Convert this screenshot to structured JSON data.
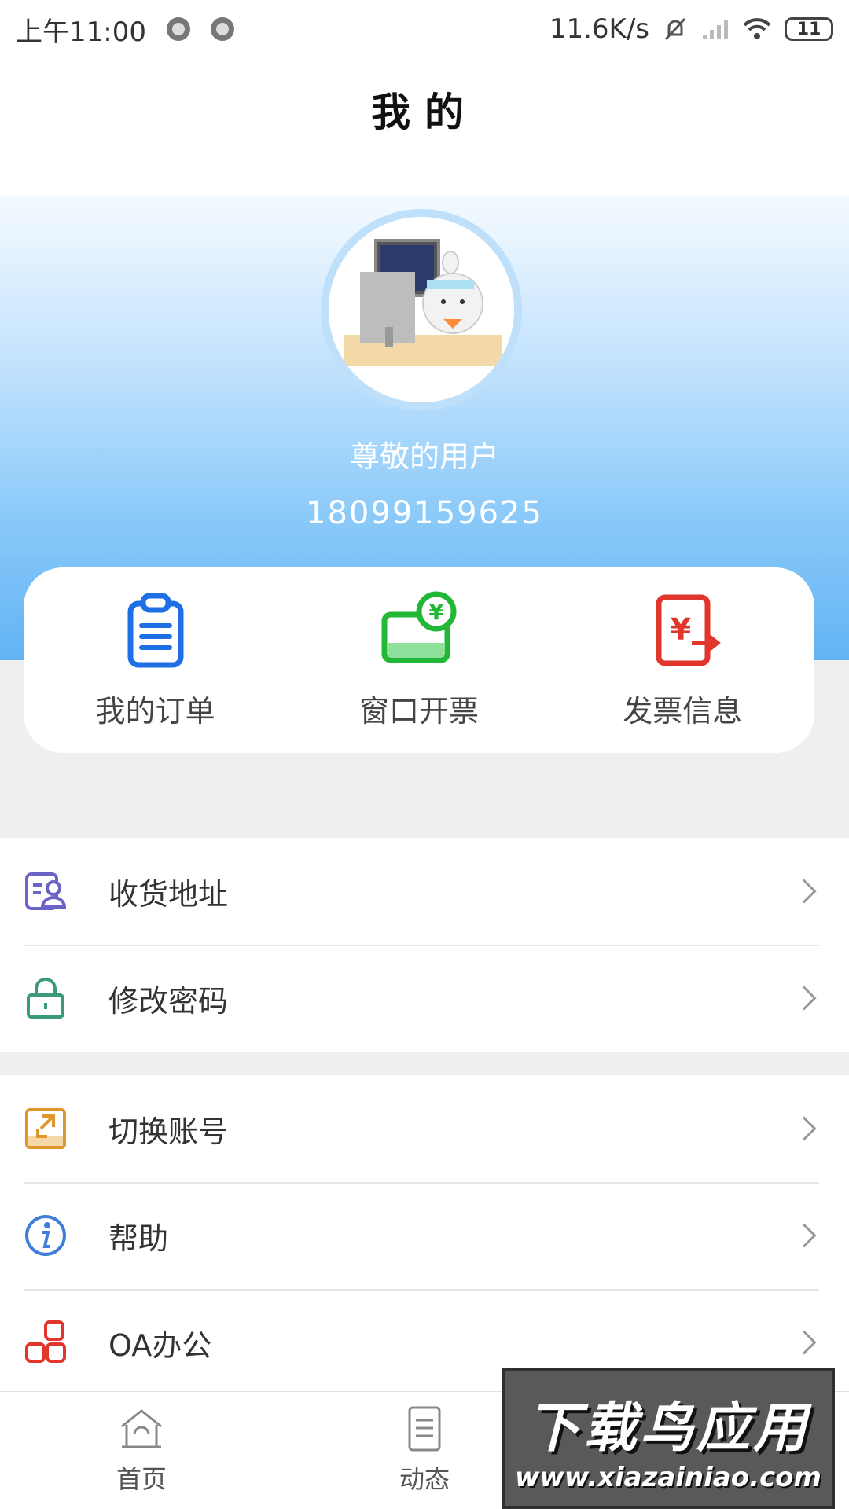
{
  "status_bar": {
    "time": "上午11:00",
    "speed": "11.6K/s",
    "battery": "11"
  },
  "header": {
    "title": "我的"
  },
  "profile": {
    "name": "尊敬的用户",
    "phone": "18099159625"
  },
  "quick_actions": [
    {
      "label": "我的订单",
      "icon": "clipboard-icon",
      "color": "#1e6fe6"
    },
    {
      "label": "窗口开票",
      "icon": "yen-card-icon",
      "color": "#22b835"
    },
    {
      "label": "发票信息",
      "icon": "yen-invoice-icon",
      "color": "#e0362c"
    }
  ],
  "menu_group_1": [
    {
      "label": "收货地址",
      "icon": "address-card-icon",
      "color": "#6a64c6"
    },
    {
      "label": "修改密码",
      "icon": "lock-icon",
      "color": "#3a9a7a"
    }
  ],
  "menu_group_2": [
    {
      "label": "切换账号",
      "icon": "switch-account-icon",
      "color": "#e0962c"
    },
    {
      "label": "帮助",
      "icon": "info-icon",
      "color": "#3f7ed8"
    },
    {
      "label": "OA办公",
      "icon": "oa-blocks-icon",
      "color": "#e0362c"
    }
  ],
  "bottom_nav": [
    {
      "label": "首页",
      "icon": "home-icon"
    },
    {
      "label": "动态",
      "icon": "document-icon"
    }
  ],
  "watermark": {
    "title": "下载鸟应用",
    "url": "www.xiazainiao.com"
  }
}
